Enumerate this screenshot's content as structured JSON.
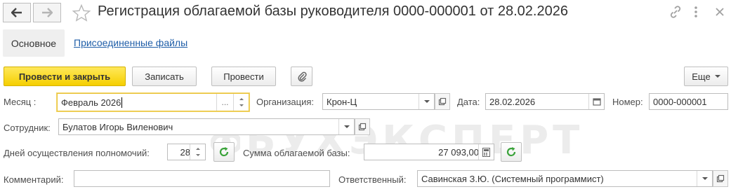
{
  "window": {
    "title": "Регистрация облагаемой базы руководителя 0000-000001 от 28.02.2026"
  },
  "tabs": {
    "main": "Основное",
    "files": "Присоединенные файлы"
  },
  "toolbar": {
    "post_close": "Провести и закрыть",
    "save": "Записать",
    "post": "Провести",
    "more": "Еще"
  },
  "form": {
    "month_label": "Месяц :",
    "month_value": "Февраль 2026",
    "month_dots": "...",
    "org_label": "Организация:",
    "org_value": "Крон-Ц",
    "date_label": "Дата:",
    "date_value": "28.02.2026",
    "number_label": "Номер:",
    "number_value": "0000-000001",
    "employee_label": "Сотрудник:",
    "employee_value": "Булатов Игорь Виленович",
    "days_label": "Дней осуществления полномочий:",
    "days_value": "28",
    "base_label": "Сумма облагаемой базы:",
    "base_value": "27 093,00",
    "comment_label": "Комментарий:",
    "comment_value": "",
    "responsible_label": "Ответственный:",
    "responsible_value": "Савинская З.Ю. (Системный программист)"
  },
  "watermark": "БУХЭКСПЕРТ",
  "colors": {
    "accent_yellow": "#f5cf00",
    "link_blue": "#1f5ea8",
    "refresh_green": "#3aa33a",
    "focus_border": "#e8c33c"
  }
}
